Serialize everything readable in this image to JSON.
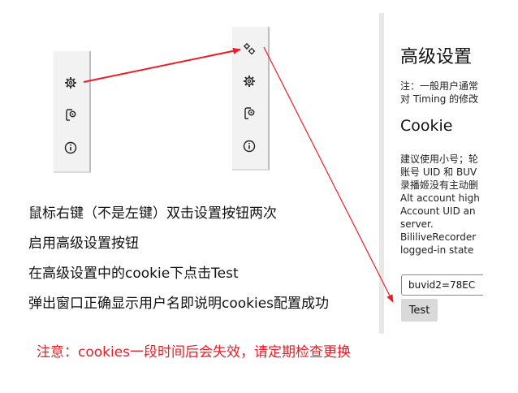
{
  "panels": {
    "left": {
      "icons": [
        "gear-icon",
        "file-lock-icon",
        "info-icon"
      ]
    },
    "right": {
      "icons": [
        "gears-icon",
        "gear-icon",
        "file-lock-icon",
        "info-icon"
      ]
    }
  },
  "instructions": [
    "鼠标右键（不是左键）双击设置按钮两次",
    "启用高级设置按钮",
    "在高级设置中的cookie下点击Test",
    "弹出窗口正确显示用户名即说明cookies配置成功"
  ],
  "warning": "注意：cookies一段时间后会失效，请定期检查更换",
  "settings": {
    "title": "高级设置",
    "note_line1": "注：一般用户通常",
    "note_line2": "对 Timing 的修改",
    "cookie_heading": "Cookie",
    "desc_lines": [
      "建议使用小号；轮",
      "账号 UID 和 BUV",
      "录播姬没有主动删",
      "Alt account high",
      "Account UID an",
      "server.",
      "BililiveRecorder",
      "logged-in state"
    ],
    "cookie_value": "buvid2=78EC",
    "test_label": "Test"
  },
  "colors": {
    "arrow": "#ee1c25",
    "warning": "#ee1c25"
  }
}
